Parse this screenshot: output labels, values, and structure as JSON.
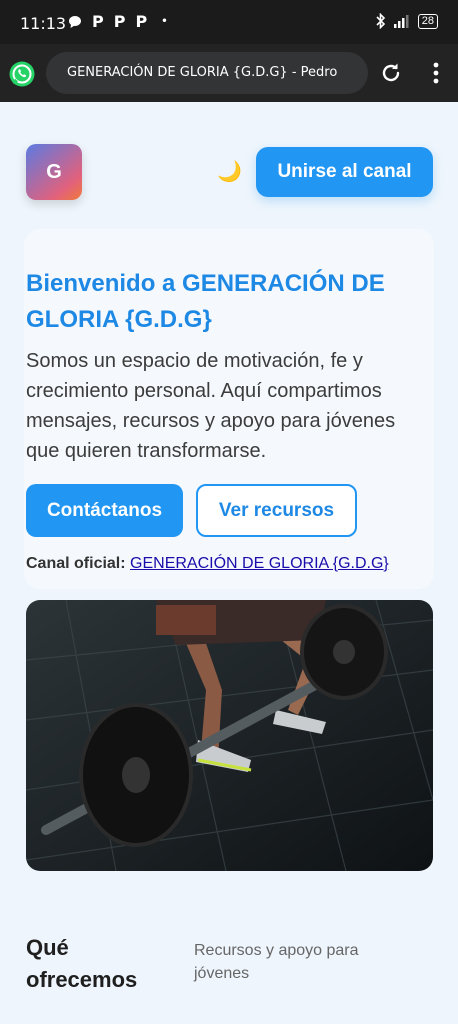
{
  "status_bar": {
    "time": "11:13",
    "app_letters": [
      "P",
      "P",
      "P"
    ],
    "dot": "•",
    "battery": "28"
  },
  "browser": {
    "title": "GENERACIÓN DE GLORIA {G.D.G} - Pedro",
    "icons": [
      "whatsapp-icon",
      "reload-icon",
      "more-vert-icon"
    ]
  },
  "header": {
    "logo_letter": "G",
    "moon": "🌙",
    "join_button": "Unirse al canal"
  },
  "hero": {
    "title": "Bienvenido a GENERACIÓN DE GLORIA {G.D.G}",
    "text": "Somos un espacio de motivación, fe y crecimiento personal. Aquí compartimos mensajes, recursos y apoyo para jóvenes que quieren transformarse.",
    "contact_button": "Contáctanos",
    "resources_button": "Ver recursos",
    "channel_label": "Canal oficial:",
    "channel_link": "GENERACIÓN DE GLORIA {G.D.G}"
  },
  "section": {
    "title": "Qué ofrecemos",
    "subtitle": "Recursos y apoyo para jóvenes"
  },
  "colors": {
    "accent": "#2196f3",
    "title_blue": "#1e88e5",
    "page_bg": "#eef5fc"
  }
}
